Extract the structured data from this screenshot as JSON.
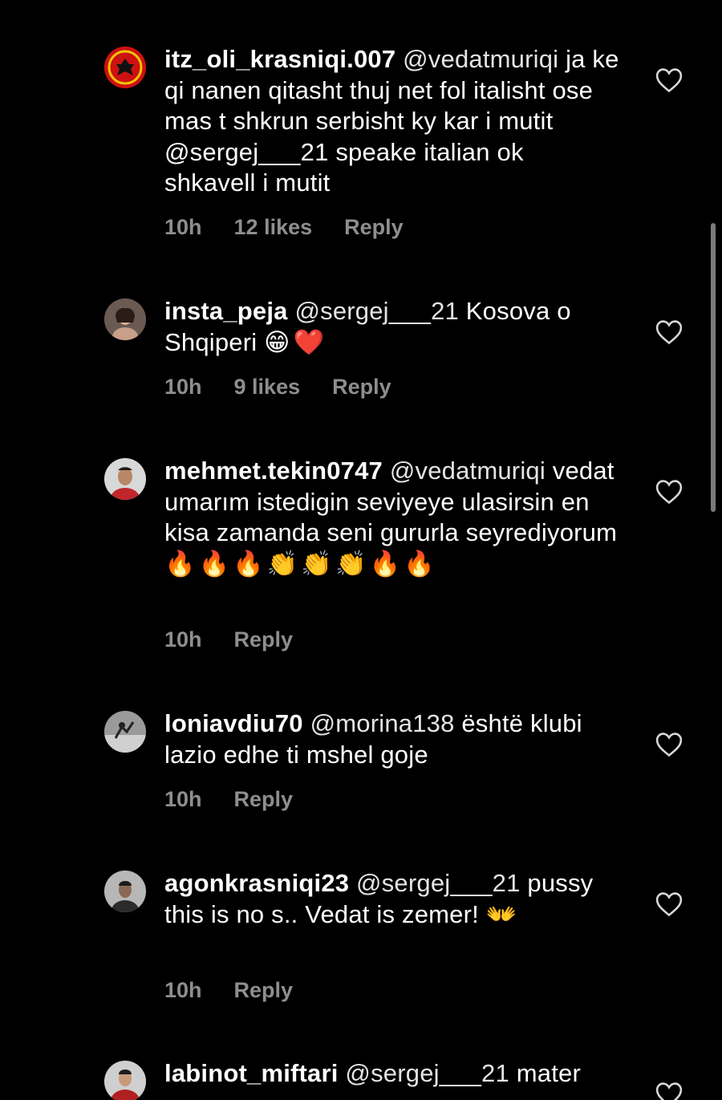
{
  "colors": {
    "background": "#000000",
    "text": "#ffffff",
    "meta": "#8e8e8e",
    "scrollbar": "#7a7a7a"
  },
  "comments": [
    {
      "username": "itz_oli_krasniqi.007",
      "mention": "@vedatmuriqi",
      "text": "ja ke qi nanen qitasht thuj net fol italisht ose mas t shkrun serbisht ky kar i mutit @sergej___21 speake italian ok shkavell i mutit",
      "emojis": "",
      "time": "10h",
      "likes": "12 likes",
      "reply": "Reply",
      "avatar_icon": "uck-emblem-avatar-icon",
      "like_icon": "heart-outline-icon"
    },
    {
      "username": "insta_peja",
      "mention": "@sergej___21",
      "text": "Kosova o Shqiperi",
      "emojis": "😁❤️",
      "time": "10h",
      "likes": "9 likes",
      "reply": "Reply",
      "avatar_icon": "person-photo-avatar-icon",
      "like_icon": "heart-outline-icon"
    },
    {
      "username": "mehmet.tekin0747",
      "mention": "@vedatmuriqi",
      "text": "vedat umarım istedigin seviyeye ulasirsin en kisa zamanda seni gururla seyrediyorum",
      "emojis": "🔥🔥🔥👏👏👏🔥🔥",
      "time": "10h",
      "likes": "",
      "reply": "Reply",
      "avatar_icon": "person-photo-avatar-icon",
      "like_icon": "heart-outline-icon"
    },
    {
      "username": "loniavdiu70",
      "mention": "@morina138",
      "text": "është klubi lazio edhe ti mshel goje",
      "emojis": "",
      "time": "10h",
      "likes": "",
      "reply": "Reply",
      "avatar_icon": "person-photo-avatar-icon",
      "like_icon": "heart-outline-icon"
    },
    {
      "username": "agonkrasniqi23",
      "mention": "@sergej___21",
      "text": "pussy this is no s.. Vedat is zemer!",
      "emojis": "👐",
      "time": "10h",
      "likes": "",
      "reply": "Reply",
      "avatar_icon": "person-photo-avatar-icon",
      "like_icon": "heart-outline-icon"
    },
    {
      "username": "labinot_miftari",
      "mention": "@sergej___21",
      "text": "mater",
      "emojis": "",
      "time": "",
      "likes": "",
      "reply": "",
      "avatar_icon": "person-photo-avatar-icon",
      "like_icon": "heart-outline-icon"
    }
  ]
}
